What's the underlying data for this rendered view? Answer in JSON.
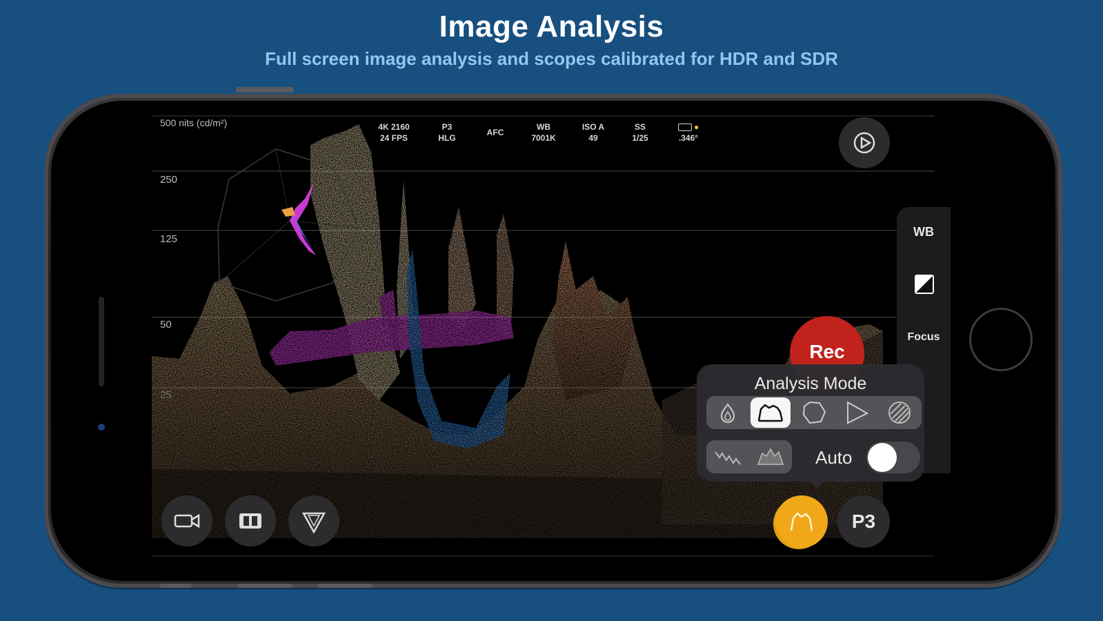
{
  "header": {
    "title": "Image Analysis",
    "subtitle": "Full screen image analysis and scopes calibrated for HDR and SDR"
  },
  "scope": {
    "top_label": "500 nits (cd/m²)",
    "levels": [
      "250",
      "125",
      "50",
      "25"
    ]
  },
  "status_bar": [
    {
      "line1": "4K 2160",
      "line2": "24 FPS"
    },
    {
      "line1": "P3",
      "line2": "HLG"
    },
    {
      "line1": "AFC",
      "line2": ""
    },
    {
      "line1": "WB",
      "line2": "7001K"
    },
    {
      "line1": "ISO A",
      "line2": "49"
    },
    {
      "line1": "SS",
      "line2": "1/25"
    },
    {
      "line1": "",
      "line2": ".346°"
    }
  ],
  "side_panel": {
    "wb_label": "WB",
    "focus_label": "Focus"
  },
  "record": {
    "label": "Rec"
  },
  "analysis_popup": {
    "title": "Analysis Mode",
    "modes": [
      "false-color-icon",
      "waveform-icon",
      "vectorscope-icon",
      "gamut-icon",
      "zebra-icon"
    ],
    "selected_mode": "waveform-icon",
    "auto_label": "Auto",
    "auto_enabled": false
  },
  "bottom_controls": {
    "p3_label": "P3"
  },
  "colors": {
    "background": "#174f7f",
    "subtitle": "#8ec8f2",
    "accent": "#f0a818",
    "rec": "#c1221c",
    "magenta_trace": "#e040e8",
    "blue_trace": "#3a8ee8"
  }
}
